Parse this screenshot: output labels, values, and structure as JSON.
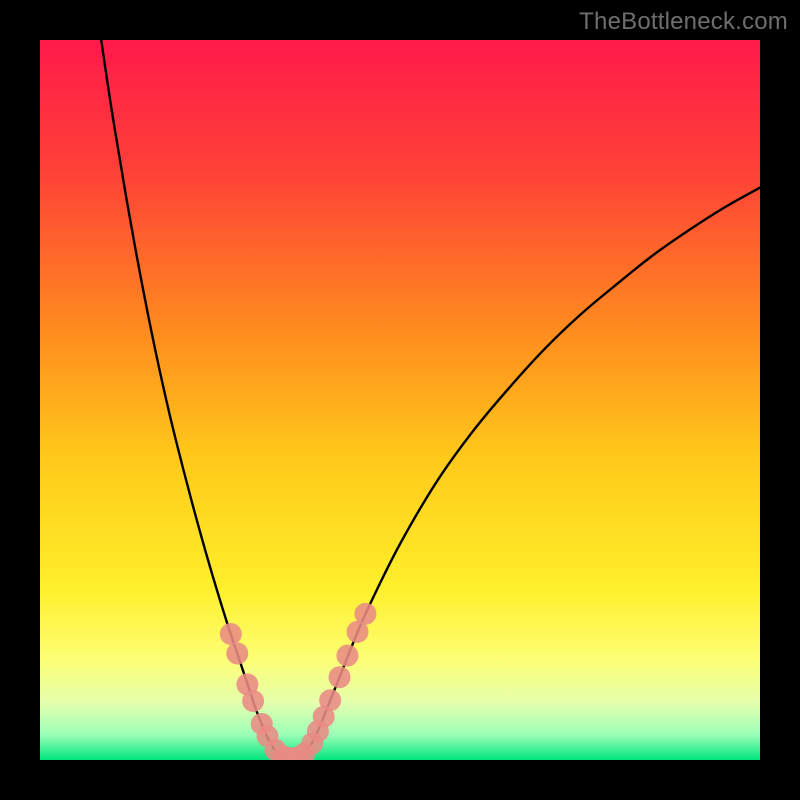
{
  "watermark": "TheBottleneck.com",
  "chart_data": {
    "type": "line",
    "title": "",
    "xlabel": "",
    "ylabel": "",
    "xlim": [
      0,
      100
    ],
    "ylim": [
      0,
      100
    ],
    "background_gradient": {
      "stops": [
        {
          "offset": 0.0,
          "color": "#ff1a4b"
        },
        {
          "offset": 0.18,
          "color": "#ff4038"
        },
        {
          "offset": 0.4,
          "color": "#ff8a1f"
        },
        {
          "offset": 0.58,
          "color": "#ffc91a"
        },
        {
          "offset": 0.76,
          "color": "#ffef2a"
        },
        {
          "offset": 0.86,
          "color": "#fdff75"
        },
        {
          "offset": 0.92,
          "color": "#e6ffad"
        },
        {
          "offset": 0.965,
          "color": "#9bffb8"
        },
        {
          "offset": 1.0,
          "color": "#00e57e"
        }
      ]
    },
    "series": [
      {
        "name": "left-curve",
        "values": [
          {
            "x": 8.5,
            "y": 100.0
          },
          {
            "x": 10.0,
            "y": 90.0
          },
          {
            "x": 12.0,
            "y": 78.0
          },
          {
            "x": 14.0,
            "y": 67.0
          },
          {
            "x": 16.0,
            "y": 57.0
          },
          {
            "x": 18.0,
            "y": 48.0
          },
          {
            "x": 20.0,
            "y": 40.0
          },
          {
            "x": 22.0,
            "y": 32.5
          },
          {
            "x": 24.0,
            "y": 25.5
          },
          {
            "x": 26.0,
            "y": 19.0
          },
          {
            "x": 28.0,
            "y": 13.0
          },
          {
            "x": 29.0,
            "y": 10.0
          },
          {
            "x": 30.0,
            "y": 7.0
          },
          {
            "x": 31.0,
            "y": 4.5
          },
          {
            "x": 32.0,
            "y": 2.3
          },
          {
            "x": 33.0,
            "y": 1.0
          },
          {
            "x": 34.0,
            "y": 0.4
          },
          {
            "x": 35.0,
            "y": 0.2
          }
        ]
      },
      {
        "name": "right-curve",
        "values": [
          {
            "x": 35.0,
            "y": 0.2
          },
          {
            "x": 36.0,
            "y": 0.5
          },
          {
            "x": 37.0,
            "y": 1.2
          },
          {
            "x": 38.0,
            "y": 2.8
          },
          {
            "x": 39.0,
            "y": 5.0
          },
          {
            "x": 40.0,
            "y": 7.5
          },
          {
            "x": 42.0,
            "y": 12.5
          },
          {
            "x": 44.0,
            "y": 17.5
          },
          {
            "x": 46.0,
            "y": 22.0
          },
          {
            "x": 50.0,
            "y": 30.0
          },
          {
            "x": 55.0,
            "y": 38.5
          },
          {
            "x": 60.0,
            "y": 45.5
          },
          {
            "x": 65.0,
            "y": 51.5
          },
          {
            "x": 70.0,
            "y": 57.0
          },
          {
            "x": 75.0,
            "y": 61.8
          },
          {
            "x": 80.0,
            "y": 66.0
          },
          {
            "x": 85.0,
            "y": 70.0
          },
          {
            "x": 90.0,
            "y": 73.5
          },
          {
            "x": 95.0,
            "y": 76.7
          },
          {
            "x": 100.0,
            "y": 79.5
          }
        ]
      }
    ],
    "markers": {
      "name": "highlight-dots",
      "color": "#e98b85",
      "radius_px": 11,
      "values": [
        {
          "x": 26.5,
          "y": 17.5
        },
        {
          "x": 27.4,
          "y": 14.8
        },
        {
          "x": 28.8,
          "y": 10.5
        },
        {
          "x": 29.6,
          "y": 8.2
        },
        {
          "x": 30.8,
          "y": 5.0
        },
        {
          "x": 31.6,
          "y": 3.3
        },
        {
          "x": 32.7,
          "y": 1.4
        },
        {
          "x": 33.8,
          "y": 0.5
        },
        {
          "x": 34.8,
          "y": 0.25
        },
        {
          "x": 35.8,
          "y": 0.35
        },
        {
          "x": 36.7,
          "y": 0.9
        },
        {
          "x": 37.8,
          "y": 2.3
        },
        {
          "x": 38.6,
          "y": 4.0
        },
        {
          "x": 39.4,
          "y": 6.0
        },
        {
          "x": 40.3,
          "y": 8.3
        },
        {
          "x": 41.6,
          "y": 11.5
        },
        {
          "x": 42.7,
          "y": 14.5
        },
        {
          "x": 44.1,
          "y": 17.8
        },
        {
          "x": 45.2,
          "y": 20.3
        }
      ]
    }
  }
}
